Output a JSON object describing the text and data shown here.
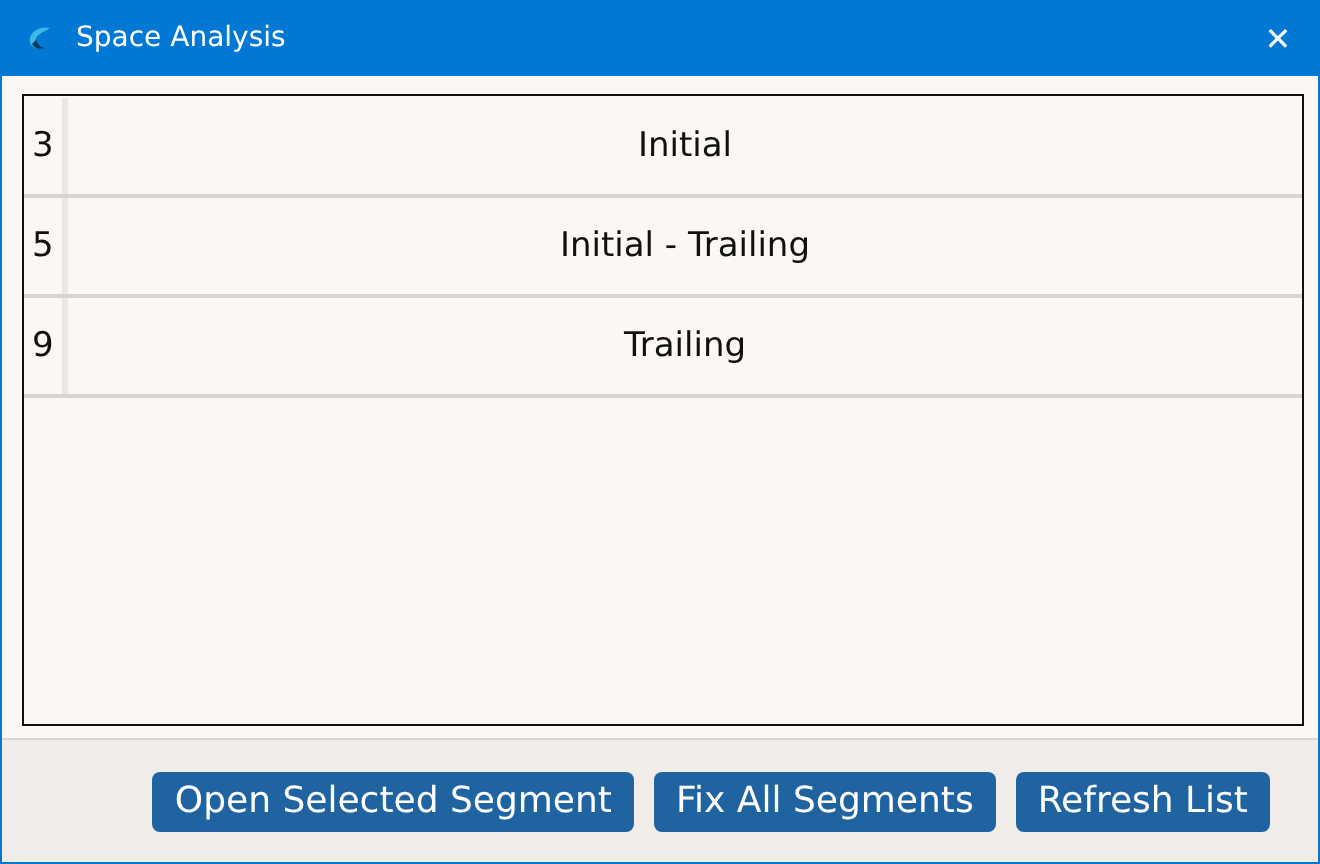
{
  "window": {
    "title": "Space Analysis",
    "close": "✕"
  },
  "rows": [
    {
      "number": "3",
      "label": "Initial"
    },
    {
      "number": "5",
      "label": "Initial - Trailing"
    },
    {
      "number": "9",
      "label": "Trailing"
    }
  ],
  "buttons": [
    "Open Selected Segment",
    "Fix All Segments",
    "Refresh List"
  ]
}
